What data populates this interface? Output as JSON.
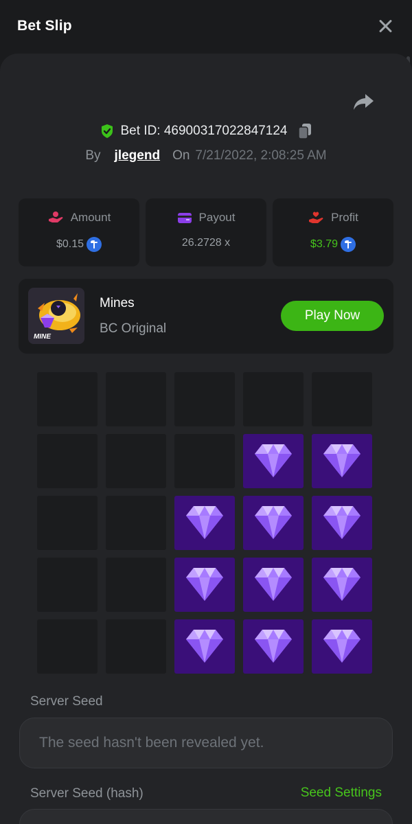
{
  "header": {
    "title": "Bet Slip"
  },
  "bet": {
    "id_text": "Bet ID: 4690031702284712​4",
    "by_label": "By",
    "user": "jlegend",
    "on_label": "On",
    "date": "7/21/2022, 2:08:25 AM"
  },
  "stats": {
    "amount": {
      "label": "Amount",
      "value": "$0.15"
    },
    "payout": {
      "label": "Payout",
      "value": "26.2728 x"
    },
    "profit": {
      "label": "Profit",
      "value": "$3.79"
    }
  },
  "game": {
    "name": "Mines",
    "subtitle": "BC Original",
    "thumb_label": "MINE",
    "play_label": "Play Now"
  },
  "board": {
    "rows": 5,
    "cols": 5,
    "cells": [
      [
        0,
        0,
        0,
        0,
        0
      ],
      [
        0,
        0,
        0,
        1,
        1
      ],
      [
        0,
        0,
        1,
        1,
        1
      ],
      [
        0,
        0,
        1,
        1,
        1
      ],
      [
        0,
        0,
        1,
        1,
        1
      ]
    ]
  },
  "seeds": {
    "server_seed_label": "Server Seed",
    "server_seed_value": "The seed hasn't been revealed yet.",
    "server_hash_label": "Server Seed (hash)",
    "seed_settings_label": "Seed Settings"
  },
  "colors": {
    "accent_green": "#3cb515",
    "profit_green": "#47c41c",
    "gem_tile": "#3a0f79",
    "coin_blue": "#2f6fe3"
  },
  "icons": {
    "close": "close-icon",
    "share": "share-icon",
    "shield": "shield-check-icon",
    "copy": "copy-icon",
    "amount": "hand-coin-icon",
    "payout": "card-icon",
    "profit": "hand-heart-icon",
    "coin": "coin-icon",
    "gem": "diamond-icon"
  }
}
